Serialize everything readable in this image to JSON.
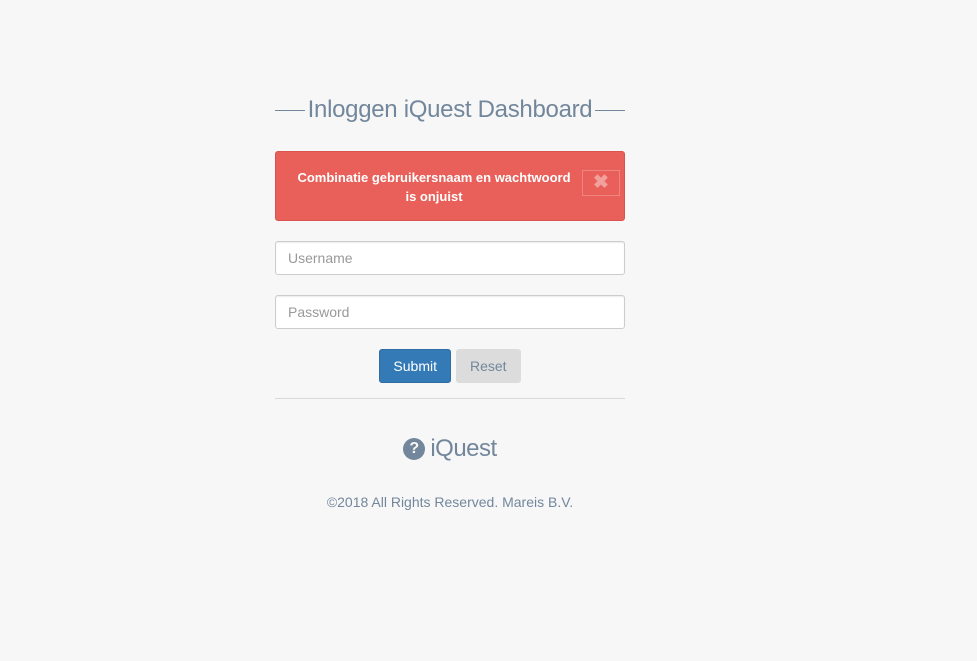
{
  "login": {
    "title": "Inloggen iQuest Dashboard",
    "alert": {
      "message": "Combinatie gebruikersnaam en wachtwoord is onjuist",
      "close_symbol": "✖",
      "color": "#e9605a"
    },
    "username": {
      "placeholder": "Username",
      "value": ""
    },
    "password": {
      "placeholder": "Password",
      "value": ""
    },
    "submit_label": "Submit",
    "reset_label": "Reset"
  },
  "footer": {
    "brand_icon": "question-circle-icon",
    "brand_icon_glyph": "?",
    "brand_name": "iQuest",
    "copyright": "©2018 All Rights Reserved. Mareis B.V."
  },
  "colors": {
    "text": "#73879c",
    "primary": "#337ab7",
    "background": "#f7f7f7"
  }
}
